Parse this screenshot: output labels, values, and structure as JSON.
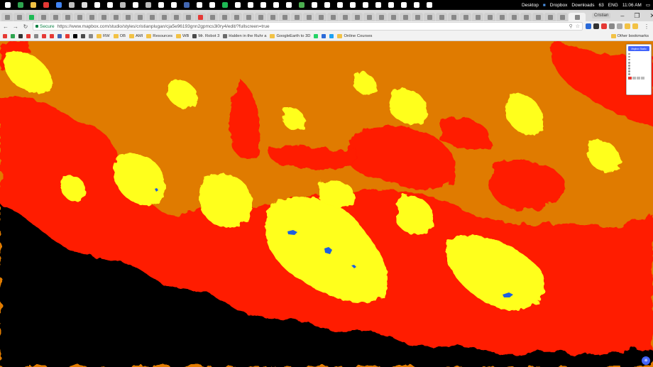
{
  "taskbar": {
    "icons": [
      "#ffffff",
      "#2ea44f",
      "#f2c245",
      "#e53935",
      "#4285f4",
      "#c0c0c0",
      "#dddddd",
      "#ffffff",
      "#ffffff",
      "#bbbbbb",
      "#ffffff",
      "#bbbbbb",
      "#ffffff",
      "#ffffff",
      "#4267b2",
      "#ffffff",
      "#ffffff",
      "#1db954",
      "#ffffff",
      "#ffffff",
      "#ffffff",
      "#ffffff",
      "#ffffff",
      "#4caf50",
      "#ffffff",
      "#ffffff",
      "#ffffff",
      "#ffffff",
      "#ffffff",
      "#ffffff",
      "#ffffff",
      "#ffffff",
      "#ffffff",
      "#ffffff"
    ],
    "desktop_label": "Desktop",
    "dropbox_label": "Dropbox",
    "downloads_label": "Downloads",
    "battery": "63",
    "language": "ENG",
    "time": "11:06 AM"
  },
  "tabs": {
    "colors": [
      "#888",
      "#888",
      "#1db954",
      "#888",
      "#888",
      "#888",
      "#888",
      "#888",
      "#888",
      "#888",
      "#888",
      "#888",
      "#888",
      "#888",
      "#888",
      "#888",
      "#e53935",
      "#888",
      "#888",
      "#888",
      "#888",
      "#888",
      "#888",
      "#888",
      "#888",
      "#888",
      "#888",
      "#888",
      "#888",
      "#888",
      "#888",
      "#888",
      "#888",
      "#888",
      "#888",
      "#888",
      "#888",
      "#888",
      "#888",
      "#888",
      "#888",
      "#888",
      "#888",
      "#888",
      "#888",
      "#888",
      "#888",
      "#888"
    ],
    "active_index": 47,
    "profile": "Cristian"
  },
  "address": {
    "secure_label": "Secure",
    "url": "https://www.mapbox.com/studio/styles/cristianplugan/cja5e96193gnn2gpmcs3l0ry4/edit/?fullscreen=true"
  },
  "extensions": [
    "#2b6ad8",
    "#333333",
    "#e53935",
    "#888888",
    "#aaaaaa",
    "#f2c245",
    "#f2c245"
  ],
  "bookmarks": [
    {
      "label": "",
      "color": "#e53935"
    },
    {
      "label": "",
      "color": "#2ea44f"
    },
    {
      "label": "",
      "color": "#333"
    },
    {
      "label": "",
      "color": "#e53935"
    },
    {
      "label": "",
      "color": "#888"
    },
    {
      "label": "",
      "color": "#e53935"
    },
    {
      "label": "",
      "color": "#e53935"
    },
    {
      "label": "",
      "color": "#4267b2"
    },
    {
      "label": "",
      "color": "#e53935"
    },
    {
      "label": "",
      "color": "#000"
    },
    {
      "label": "",
      "color": "#4a4a4a"
    },
    {
      "label": "",
      "color": "#888"
    },
    {
      "label": "RW",
      "folder": true
    },
    {
      "label": "OB",
      "folder": true
    },
    {
      "label": "AMI",
      "folder": true
    },
    {
      "label": "Resources",
      "folder": true
    },
    {
      "label": "WB",
      "folder": true
    },
    {
      "label": "Mr. Robot 3",
      "color": "#4a4a4a"
    },
    {
      "label": "Halden in the Ruhr a",
      "color": "#6b6b6b"
    },
    {
      "label": "GoogleEarth to 3D",
      "folder": true
    },
    {
      "label": "",
      "color": "#25d366"
    },
    {
      "label": "",
      "color": "#2b6ad8"
    },
    {
      "label": "",
      "color": "#1da1f2"
    },
    {
      "label": "Online Courses",
      "folder": true
    }
  ],
  "other_bookmarks": "Other bookmarks",
  "panel": {
    "title": "Mapbox Studio",
    "layers": [
      "",
      "",
      "",
      "",
      "",
      "",
      "",
      ""
    ],
    "coords": ""
  },
  "colors": {
    "orange": "#e07b00",
    "red": "#ff1a00",
    "yellow": "#ffff1a",
    "black": "#000000",
    "lake": "#1e5fe0"
  }
}
